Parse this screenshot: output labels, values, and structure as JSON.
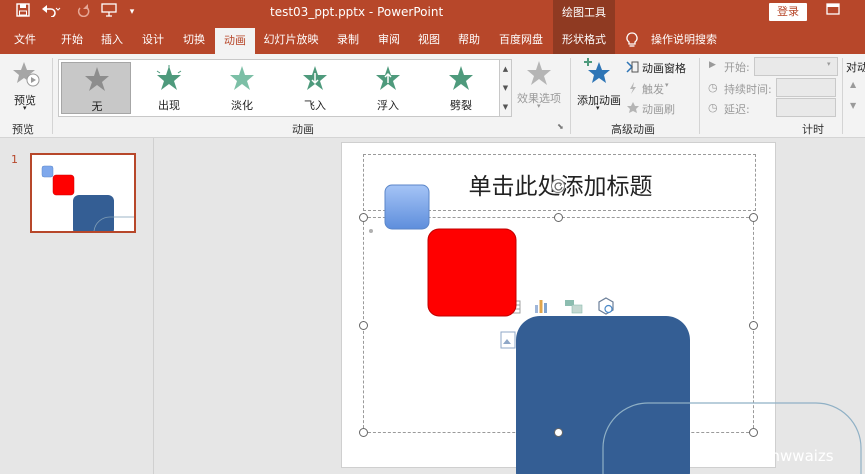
{
  "window": {
    "title": "test03_ppt.pptx  -  PowerPoint",
    "context_tab_group": "绘图工具",
    "login_label": "登录",
    "icons": [
      "save-icon",
      "undo-icon",
      "redo-icon",
      "present-icon",
      "customize-icon",
      "restore-icon"
    ]
  },
  "tabs": [
    {
      "label": "文件"
    },
    {
      "label": "开始"
    },
    {
      "label": "插入"
    },
    {
      "label": "设计"
    },
    {
      "label": "切换"
    },
    {
      "label": "动画"
    },
    {
      "label": "幻灯片放映"
    },
    {
      "label": "录制"
    },
    {
      "label": "审阅"
    },
    {
      "label": "视图"
    },
    {
      "label": "帮助"
    },
    {
      "label": "百度网盘"
    },
    {
      "label": "形状格式"
    },
    {
      "label": "操作说明搜索"
    }
  ],
  "active_tab": "动画",
  "ribbon": {
    "preview": {
      "button_label": "预览",
      "group_label": "预览"
    },
    "animation_gallery": {
      "items": [
        {
          "label": "无",
          "selected": true,
          "color": "#8d8d8d"
        },
        {
          "label": "出现",
          "selected": false,
          "color": "#4e9a7c"
        },
        {
          "label": "淡化",
          "selected": false,
          "color": "#7cbfa6"
        },
        {
          "label": "飞入",
          "selected": false,
          "color": "#4e9a7c"
        },
        {
          "label": "浮入",
          "selected": false,
          "color": "#4e9a7c"
        },
        {
          "label": "劈裂",
          "selected": false,
          "color": "#4e9a7c"
        }
      ],
      "effect_options_label": "效果选项",
      "group_label": "动画"
    },
    "advanced": {
      "add_animation_label": "添加动画",
      "animation_pane_label": "动画窗格",
      "trigger_label": "触发",
      "painter_label": "动画刷",
      "group_label": "高级动画"
    },
    "timing": {
      "start_label": "开始:",
      "duration_label": "持续时间:",
      "delay_label": "延迟:",
      "reorder_label": "对动",
      "group_label": "计时"
    }
  },
  "slides_pane": {
    "slide_number": "1"
  },
  "slide": {
    "title_placeholder": "单击此处添加标题",
    "shapes": [
      {
        "name": "small-blue-square",
        "color": "#7fa8ec"
      },
      {
        "name": "red-square",
        "color": "#ff0000"
      },
      {
        "name": "dark-blue-square",
        "color": "#345e94"
      }
    ]
  },
  "watermark": "CSDN @hwwaizs",
  "colors": {
    "accent": "#b7472a",
    "context_tab": "#8f3a22",
    "ribbon_bg": "#f3f3f3"
  }
}
